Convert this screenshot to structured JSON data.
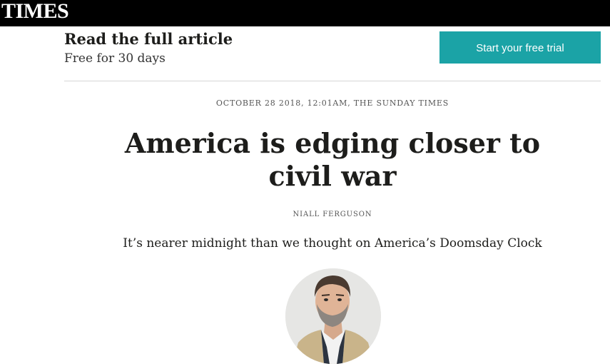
{
  "masthead": {
    "logo_text": "TIMES"
  },
  "promo": {
    "title": "Read the full article",
    "subtitle": "Free for 30 days",
    "cta_label": "Start your free trial",
    "cta_color": "#1ba3a6"
  },
  "article": {
    "dateline": "OCTOBER 28 2018, 12:01AM, THE SUNDAY TIMES",
    "headline_line1": "America is edging closer to",
    "headline_line2": "civil war",
    "byline": "NIALL FERGUSON",
    "standfirst": "It’s nearer midnight than we thought on America’s Doomsday Clock",
    "author_photo": "author-portrait"
  }
}
